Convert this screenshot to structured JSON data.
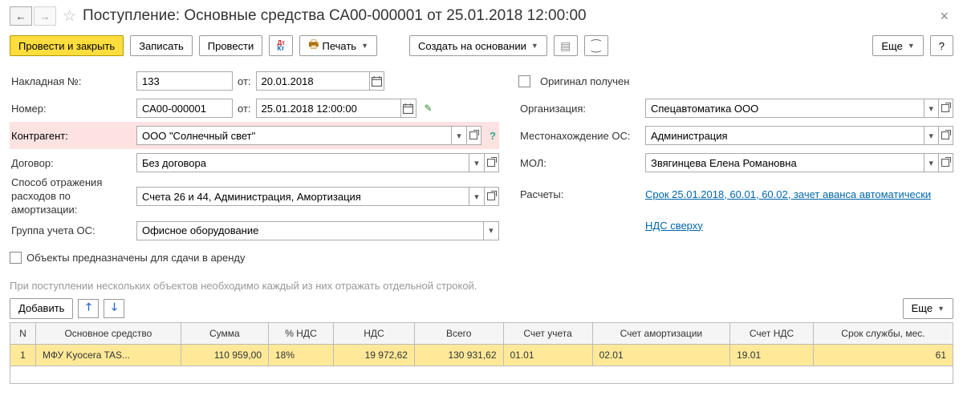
{
  "header": {
    "title": "Поступление: Основные средства СА00-000001 от 25.01.2018 12:00:00"
  },
  "toolbar": {
    "post_close": "Провести и закрыть",
    "save": "Записать",
    "post": "Провести",
    "print": "Печать",
    "create_based": "Создать на основании",
    "more": "Еще",
    "help": "?"
  },
  "form": {
    "invoice_no_label": "Накладная №:",
    "invoice_no": "133",
    "from_label": "от:",
    "invoice_date": "20.01.2018",
    "number_label": "Номер:",
    "number": "СА00-000001",
    "number_date": "25.01.2018 12:00:00",
    "contragent_label": "Контрагент:",
    "contragent": "ООО \"Солнечный свет\"",
    "contract_label": "Договор:",
    "contract": "Без договора",
    "exp_method_label": "Способ отражения расходов по амортизации:",
    "exp_method": "Счета 26 и 44, Администрация, Амортизация",
    "os_group_label": "Группа учета ОС:",
    "os_group": "Офисное оборудование",
    "lease_label": "Объекты предназначены для сдачи в аренду",
    "original_label": "Оригинал получен",
    "org_label": "Организация:",
    "org": "Спецавтоматика ООО",
    "location_label": "Местонахождение ОС:",
    "location": "Администрация",
    "mol_label": "МОЛ:",
    "mol": "Звягинцева Елена Романовна",
    "calc_label": "Расчеты:",
    "calc_link": "Срок 25.01.2018, 60.01, 60.02, зачет аванса автоматически",
    "vat_link": "НДС сверху"
  },
  "note": "При поступлении нескольких объектов необходимо каждый из них отражать отдельной строкой.",
  "table_toolbar": {
    "add": "Добавить",
    "more": "Еще"
  },
  "table": {
    "cols": {
      "n": "N",
      "asset": "Основное средство",
      "sum": "Сумма",
      "vat_pct": "% НДС",
      "vat": "НДС",
      "total": "Всего",
      "acct": "Счет учета",
      "acct_amort": "Счет амортизации",
      "acct_vat": "Счет НДС",
      "life": "Срок службы, мес."
    },
    "rows": [
      {
        "n": "1",
        "asset": "МФУ Kyocera TAS...",
        "sum": "110 959,00",
        "vat_pct": "18%",
        "vat": "19 972,62",
        "total": "130 931,62",
        "acct": "01.01",
        "acct_amort": "02.01",
        "acct_vat": "19.01",
        "life": "61"
      }
    ]
  }
}
